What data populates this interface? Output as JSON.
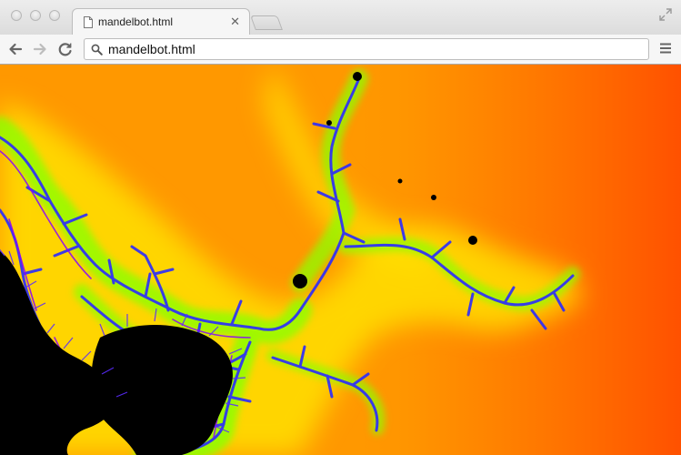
{
  "browser": {
    "tab": {
      "title": "mandelbot.html"
    },
    "address_bar": {
      "url": "mandelbot.html"
    },
    "icons": {
      "close": "close-icon",
      "minimize": "minimize-icon",
      "maximize": "maximize-icon",
      "fullscreen": "fullscreen-icon",
      "back": "back-arrow-icon",
      "forward": "forward-arrow-icon",
      "reload": "reload-icon",
      "search": "search-icon",
      "menu": "hamburger-menu-icon",
      "page": "page-icon"
    }
  },
  "page": {
    "content": "fractal-render",
    "colors": {
      "background_orange": "#ff8c00",
      "glow_yellow": "#ffe600",
      "edge_green": "#7dff00",
      "edge_cyan": "#00ffc8",
      "filament_blue": "#2c2cff",
      "filament_purple": "#7a00ff",
      "set_black": "#000000"
    }
  }
}
